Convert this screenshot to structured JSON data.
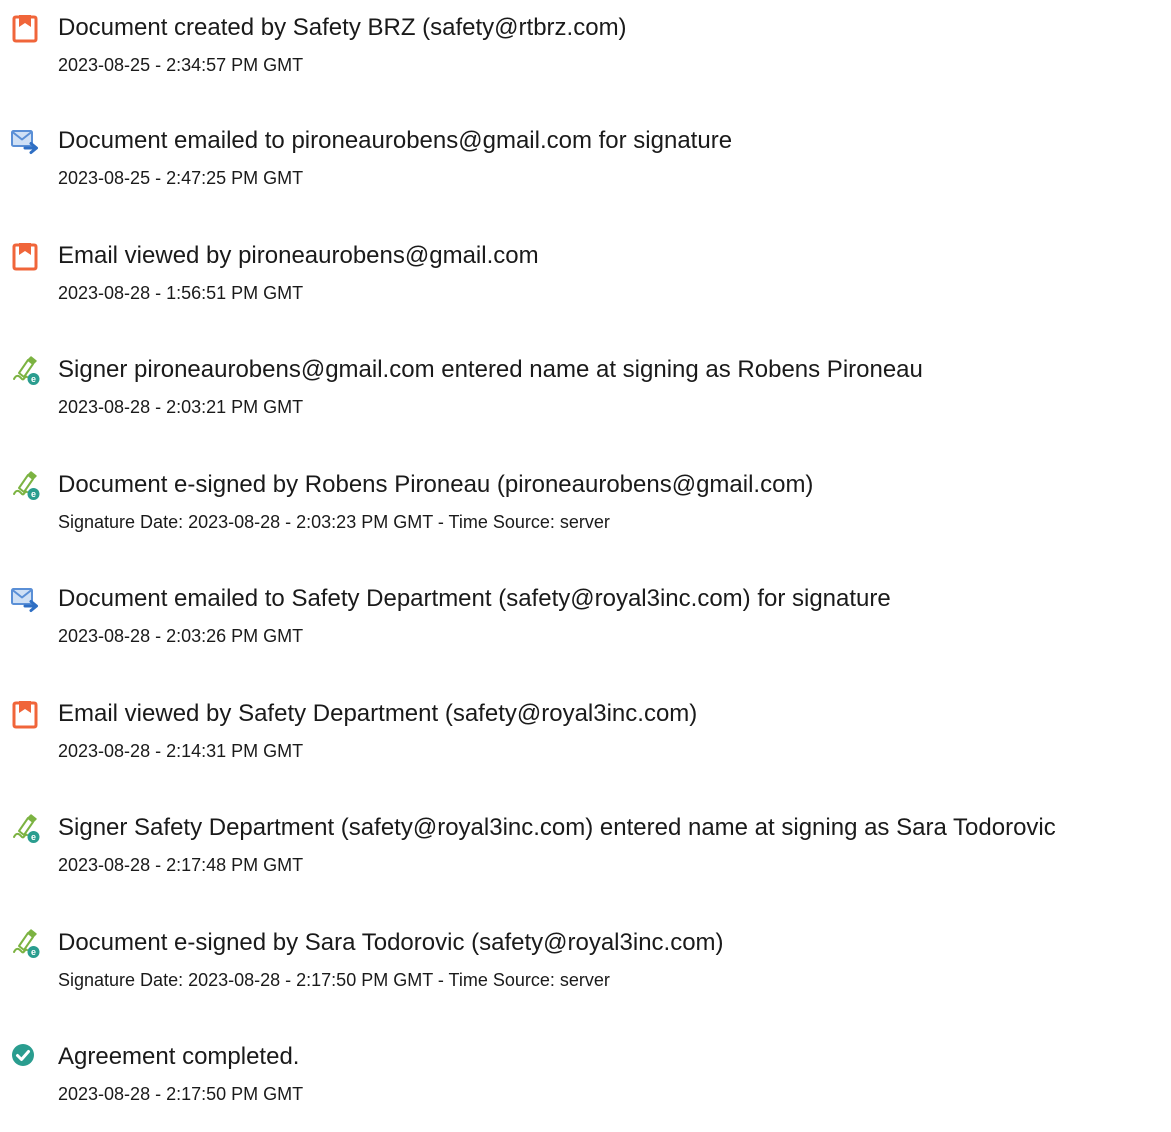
{
  "events": [
    {
      "icon": "document-orange-icon",
      "title": "Document created by Safety BRZ (safety@rtbrz.com)",
      "detail": "2023-08-25 - 2:34:57 PM GMT"
    },
    {
      "icon": "email-sent-icon",
      "title": "Document emailed to pironeaurobens@gmail.com for signature",
      "detail": "2023-08-25 - 2:47:25 PM GMT"
    },
    {
      "icon": "document-orange-icon",
      "title": "Email viewed by pironeaurobens@gmail.com",
      "detail": "2023-08-28 - 1:56:51 PM GMT"
    },
    {
      "icon": "pen-signature-icon",
      "title": "Signer pironeaurobens@gmail.com entered name at signing as Robens Pironeau",
      "detail": "2023-08-28 - 2:03:21 PM GMT"
    },
    {
      "icon": "pen-signature-icon",
      "title": "Document e-signed by Robens Pironeau (pironeaurobens@gmail.com)",
      "detail": "Signature Date: 2023-08-28 - 2:03:23 PM GMT - Time Source: server"
    },
    {
      "icon": "email-sent-icon",
      "title": "Document emailed to Safety Department (safety@royal3inc.com) for signature",
      "detail": "2023-08-28 - 2:03:26 PM GMT"
    },
    {
      "icon": "document-orange-icon",
      "title": "Email viewed by Safety Department (safety@royal3inc.com)",
      "detail": "2023-08-28 - 2:14:31 PM GMT"
    },
    {
      "icon": "pen-signature-icon",
      "title": "Signer Safety Department (safety@royal3inc.com) entered name at signing as Sara Todorovic",
      "detail": "2023-08-28 - 2:17:48 PM GMT"
    },
    {
      "icon": "pen-signature-icon",
      "title": "Document e-signed by Sara Todorovic (safety@royal3inc.com)",
      "detail": "Signature Date: 2023-08-28 - 2:17:50 PM GMT - Time Source: server"
    },
    {
      "icon": "check-circle-icon",
      "title": "Agreement completed.",
      "detail": "2023-08-28 - 2:17:50 PM GMT"
    }
  ],
  "colors": {
    "document_icon": "#f0653a",
    "email_icon": "#5a8fd6",
    "pen_icon": "#7cb342",
    "check_icon": "#2a9d8f",
    "text": "#1a1a1a"
  }
}
